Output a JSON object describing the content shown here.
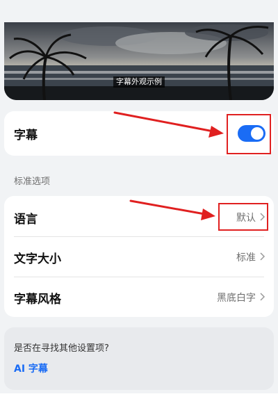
{
  "preview": {
    "caption": "字幕外观示例"
  },
  "captions": {
    "label": "字幕",
    "enabled": true
  },
  "standard_options": {
    "title": "标准选项",
    "rows": [
      {
        "label": "语言",
        "value": "默认"
      },
      {
        "label": "文字大小",
        "value": "标准"
      },
      {
        "label": "字幕风格",
        "value": "黑底白字"
      }
    ]
  },
  "search": {
    "question": "是否在寻找其他设置项?",
    "link": "AI 字幕"
  },
  "colors": {
    "accent": "#1a6cf5",
    "annotation": "#e02020"
  },
  "icons": [
    "chevron-right-icon",
    "toggle-switch"
  ]
}
